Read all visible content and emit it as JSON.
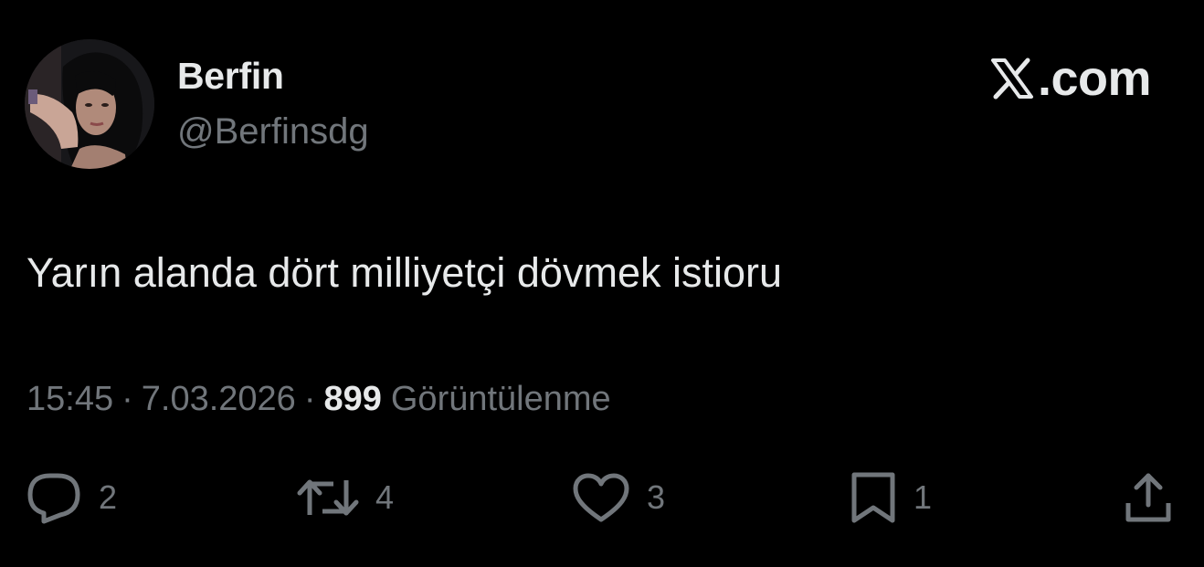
{
  "user": {
    "display_name": "Berfin",
    "handle": "@Berfinsdg"
  },
  "brand": {
    "icon": "x-logo-icon",
    "text": ".com"
  },
  "tweet": {
    "text": "Yarın alanda dört milliyetçi dövmek istioru",
    "time": "15:45",
    "date": "7.03.2026",
    "views_count": "899",
    "views_label": "Görüntülenme",
    "separator": "·"
  },
  "actions": {
    "reply": {
      "icon": "reply-icon",
      "count": "2"
    },
    "retweet": {
      "icon": "retweet-icon",
      "count": "4"
    },
    "like": {
      "icon": "heart-icon",
      "count": "3"
    },
    "bookmark": {
      "icon": "bookmark-icon",
      "count": "1"
    },
    "share": {
      "icon": "share-icon"
    }
  },
  "colors": {
    "background": "#000000",
    "primary_text": "#e7e9ea",
    "secondary_text": "#71767b"
  }
}
